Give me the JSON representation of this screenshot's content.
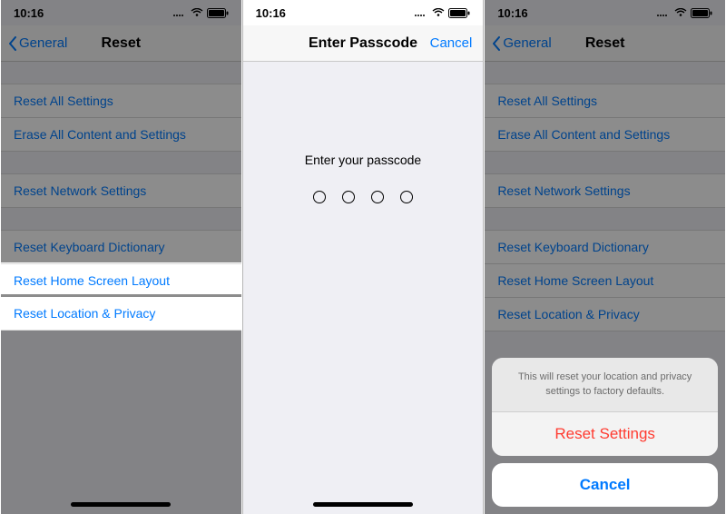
{
  "status": {
    "time": "10:16"
  },
  "panel1": {
    "back": "General",
    "title": "Reset",
    "groups": [
      [
        "Reset All Settings",
        "Erase All Content and Settings"
      ],
      [
        "Reset Network Settings"
      ],
      [
        "Reset Keyboard Dictionary",
        "Reset Home Screen Layout",
        "Reset Location & Privacy"
      ]
    ],
    "selected_row": "Reset Location & Privacy"
  },
  "panel2": {
    "title": "Enter Passcode",
    "cancel": "Cancel",
    "prompt": "Enter your passcode",
    "passcode_length": 4
  },
  "panel3": {
    "back": "General",
    "title": "Reset",
    "groups": [
      [
        "Reset All Settings",
        "Erase All Content and Settings"
      ],
      [
        "Reset Network Settings"
      ],
      [
        "Reset Keyboard Dictionary",
        "Reset Home Screen Layout",
        "Reset Location & Privacy"
      ]
    ],
    "sheet": {
      "message": "This will reset your location and privacy settings to factory defaults.",
      "destructive": "Reset Settings",
      "cancel": "Cancel"
    }
  }
}
